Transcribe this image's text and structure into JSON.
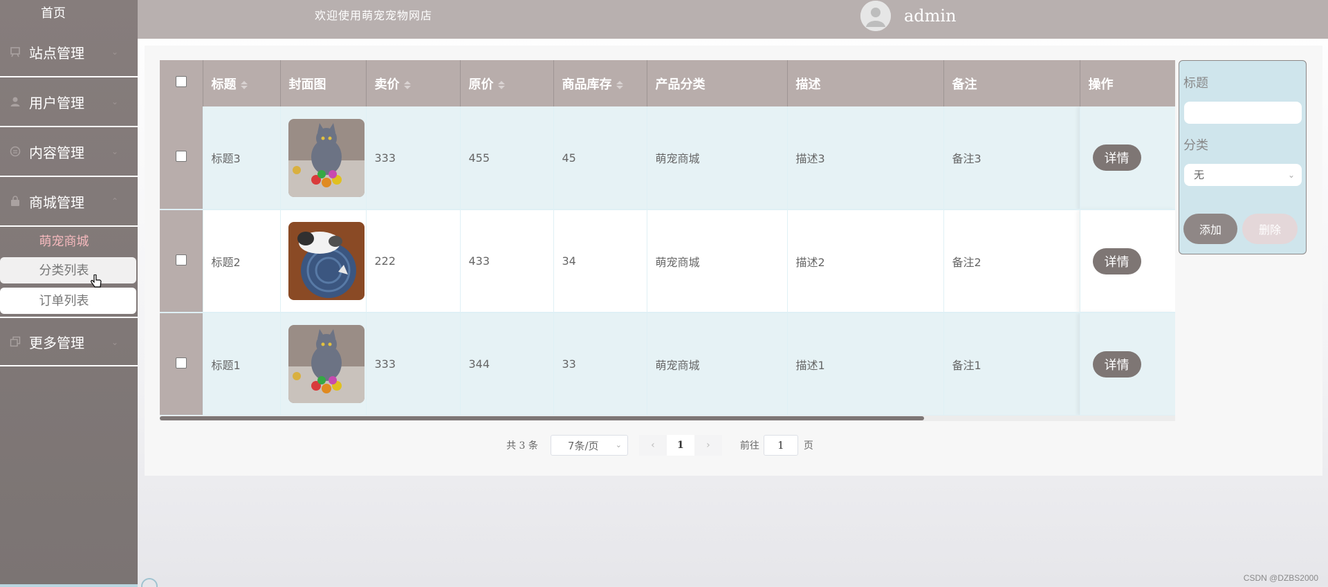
{
  "sidebar": {
    "home": "首页",
    "menus": [
      {
        "label": "站点管理",
        "icon": "easel-icon"
      },
      {
        "label": "用户管理",
        "icon": "user-icon"
      },
      {
        "label": "内容管理",
        "icon": "chat-icon"
      },
      {
        "label": "商城管理",
        "icon": "bag-icon"
      },
      {
        "label": "更多管理",
        "icon": "copy-icon"
      }
    ],
    "submenu_title": "萌宠商城",
    "submenu_items": [
      "分类列表",
      "订单列表"
    ]
  },
  "header": {
    "welcome": "欢迎使用萌宠宠物网店",
    "username": "admin"
  },
  "table": {
    "columns": [
      "标题",
      "封面图",
      "卖价",
      "原价",
      "商品库存",
      "产品分类",
      "描述",
      "备注",
      "操作"
    ],
    "rows": [
      {
        "title": "标题3",
        "cover": "gray-cat-with-toys",
        "price": "333",
        "original": "455",
        "stock": "45",
        "category": "萌宠商城",
        "desc": "描述3",
        "note": "备注3",
        "action": "详情"
      },
      {
        "title": "标题2",
        "cover": "cat-on-blue-bed",
        "price": "222",
        "original": "433",
        "stock": "34",
        "category": "萌宠商城",
        "desc": "描述2",
        "note": "备注2",
        "action": "详情"
      },
      {
        "title": "标题1",
        "cover": "gray-cat-with-toys",
        "price": "333",
        "original": "344",
        "stock": "33",
        "category": "萌宠商城",
        "desc": "描述1",
        "note": "备注1",
        "action": "详情"
      }
    ]
  },
  "pagination": {
    "total": "共 3 条",
    "page_size": "7条/页",
    "prev": "‹",
    "current": "1",
    "next": "›",
    "goto_label": "前往",
    "goto_value": "1",
    "page_suffix": "页"
  },
  "form": {
    "title_label": "标题",
    "category_label": "分类",
    "category_value": "无",
    "add_label": "添加",
    "delete_label": "删除"
  },
  "watermark": "CSDN @DZBS2000",
  "colors": {
    "sidebar_bg": "#7f7877",
    "header_bg": "#b8b0af",
    "table_header": "#b8adab",
    "row_alt": "#e6f2f5",
    "accent_pink": "#f5b9bd",
    "form_bg": "#cfe5ec"
  }
}
